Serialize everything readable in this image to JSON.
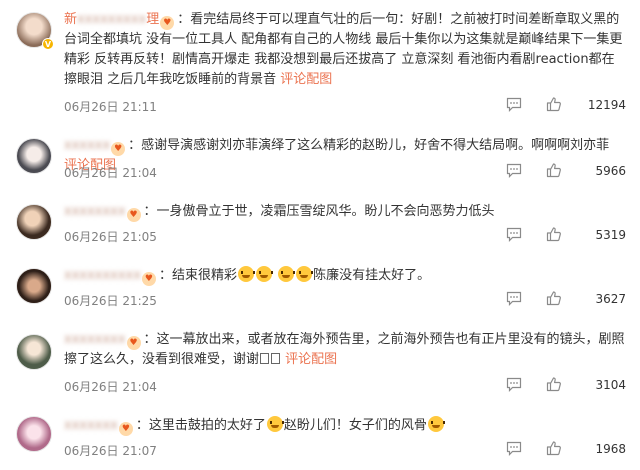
{
  "comments": [
    {
      "username": "新",
      "username_tail": "理",
      "segments": [
        "：看完结局终于可以理直气壮的后一句：好剧！之前被打时间差断章取义黑的台词全都填坑 没有一位工具人 配角都有自己的人物线 最后十集你以为这集就是巅峰结果下一集更精彩 反转再反转！剧情高开爆走 我都没想到最后还拔高了 立意深刻 看池衙内看剧reaction都在擦眼泪 之后几年我吃饭睡前的背景音",
        "评论配图"
      ],
      "time": "06月26日 21:11",
      "likes": "12194",
      "avatar_color": "#d9c3b0"
    },
    {
      "username": "",
      "segments": [
        "：感谢导演感谢刘亦菲演绎了这么精彩的赵盼儿，好舍不得大结局啊。啊啊啊刘亦菲",
        "评论配图"
      ],
      "time": "06月26日 21:04",
      "likes": "5966",
      "avatar_color": "#c9c9d6"
    },
    {
      "username": "",
      "segments": [
        "：一身傲骨立于世，凌霜压雪绽风华。盼儿不会向恶势力低头"
      ],
      "time": "06月26日 21:05",
      "likes": "5319",
      "avatar_color": "#b89a78"
    },
    {
      "username": "",
      "segments": [
        "：结束很精彩",
        "陈廉没有挂太好了。"
      ],
      "time": "06月26日 21:25",
      "likes": "3627",
      "avatar_color": "#7d5a4a"
    },
    {
      "username": "",
      "segments": [
        "：这一幕放出来，或者放在海外预告里，之前海外预告也有正片里没有的镜头，剧照擦了这么久，没看到很难受，谢谢",
        "评论配图"
      ],
      "time": "06月26日 21:04",
      "likes": "3104",
      "avatar_color": "#a7b7a0"
    },
    {
      "username": "",
      "segments": [
        "：这里击鼓拍的太好了",
        "赵盼儿们！女子们的风骨"
      ],
      "time": "06月26日 21:07",
      "likes": "1968",
      "avatar_color": "#e8b6c9"
    }
  ],
  "colors": {
    "accent": "#eb7350",
    "meta": "#808080",
    "text": "#333333"
  },
  "icons": {
    "reply": "reply-icon",
    "like": "thumbs-up-icon",
    "fan": "fan-badge-icon",
    "verified": "verified-v-icon"
  }
}
